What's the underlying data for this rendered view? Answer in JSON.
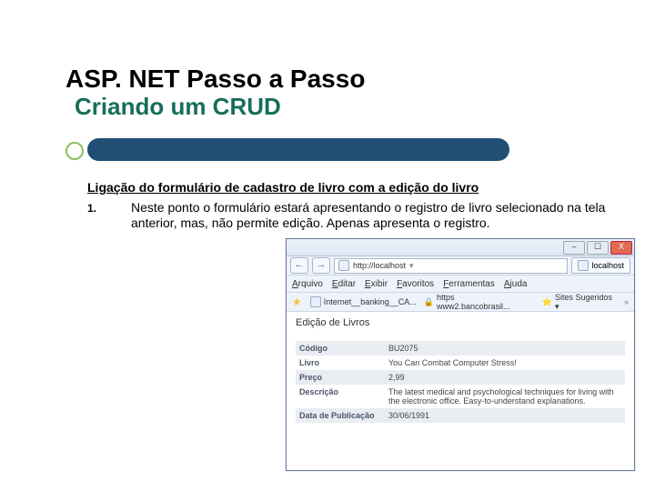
{
  "title": {
    "line1": "ASP. NET Passo a Passo",
    "line2": "Criando um CRUD"
  },
  "body": {
    "heading": "Ligação do formulário de cadastro de livro com a edição do livro",
    "list_number": "1.",
    "list_text": "Neste ponto o formulário estará apresentando o registro de livro selecionado na tela anterior, mas, não permite edição. Apenas apresenta o registro."
  },
  "browser": {
    "window_buttons": {
      "min": "–",
      "max": "☐",
      "close": "X"
    },
    "nav": {
      "back": "←",
      "forward": "→"
    },
    "address": "http://localhost",
    "tab_label": "localhost",
    "menu": {
      "arquivo": "Arquivo",
      "editar": "Editar",
      "exibir": "Exibir",
      "favoritos": "Favoritos",
      "ferramentas": "Ferramentas",
      "ajuda": "Ajuda"
    },
    "favorites": {
      "star": "★",
      "item1": "Internet__banking__CA...",
      "item2_icon": "🔒",
      "item2": "https www2.bancobrasil...",
      "suggested_icon": "⭐",
      "suggested": "Sites Sugeridos ▾",
      "expand": "»"
    },
    "page": {
      "title": "Edição de Livros",
      "rows": [
        {
          "label": "Código",
          "value": "BU2075"
        },
        {
          "label": "Livro",
          "value": "You Can Combat Computer Stress!"
        },
        {
          "label": "Preço",
          "value": "2,99"
        },
        {
          "label": "Descrição",
          "value": "The latest medical and psychological techniques for living with the electronic office. Easy-to-understand explanations."
        },
        {
          "label": "Data de Publicação",
          "value": "30/06/1991"
        }
      ]
    }
  }
}
